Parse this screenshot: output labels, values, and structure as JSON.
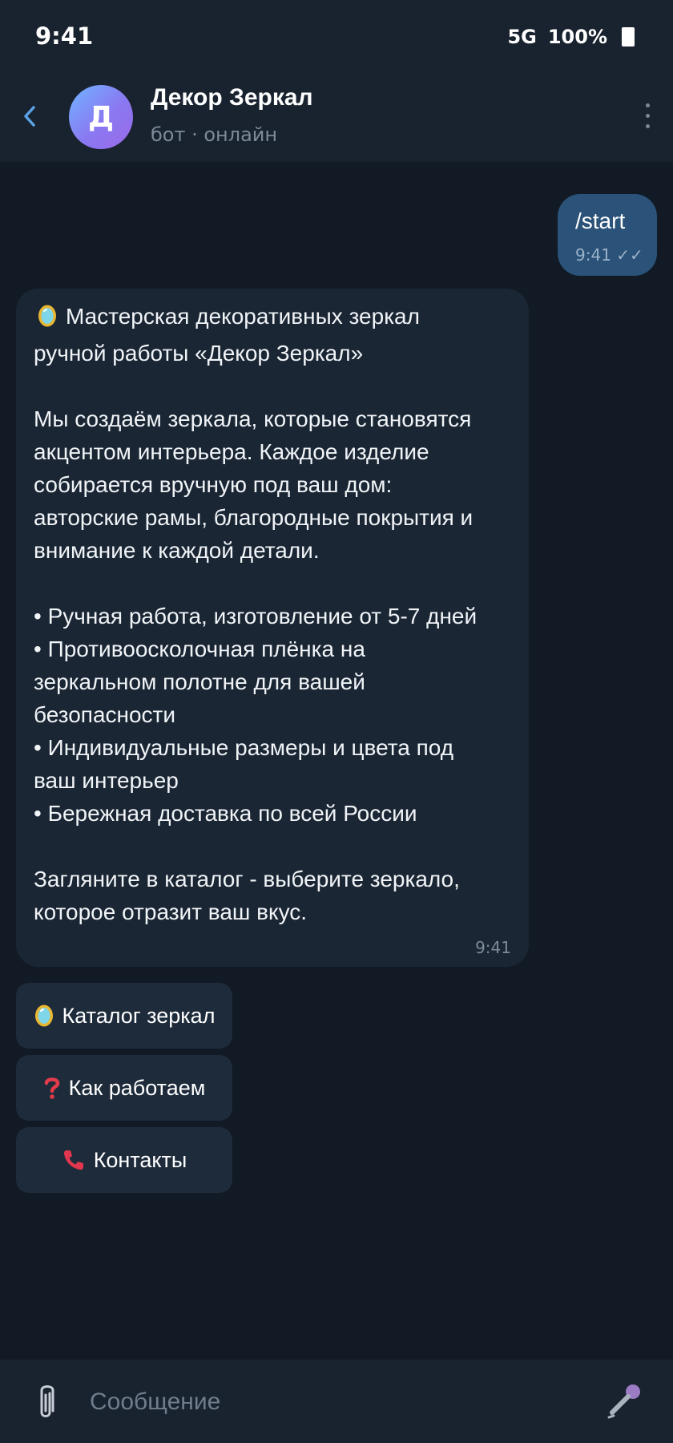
{
  "status_bar": {
    "time": "9:41",
    "network": "5G",
    "battery": "100%"
  },
  "header": {
    "avatar_letter": "Д",
    "title": "Декор Зеркал",
    "subtitle": "бот · онлайн"
  },
  "messages": {
    "outgoing": {
      "text": "/start",
      "time": "9:41 ✓✓"
    },
    "incoming": {
      "lines": [
        "Мастерская декоративных зеркал",
        "ручной работы «Декор Зеркал»",
        "Мы создаём зеркала, которые становятся",
        "акцентом интерьера. Каждое изделие",
        "собирается вручную под ваш дом:",
        "авторские рамы, благородные покрытия и",
        "внимание к каждой детали.",
        "• Ручная работа, изготовление от 5-7 дней",
        "• Противоосколочная плёнка на",
        "зеркальном полотне для вашей",
        "безопасности",
        "• Индивидуальные размеры и цвета под",
        "ваш интерьер",
        "• Бережная доставка по всей России",
        "Загляните в каталог - выберите зеркало,",
        "которое отразит ваш вкус."
      ],
      "time": "9:41"
    }
  },
  "inline_buttons": [
    {
      "label": "Каталог зеркал",
      "icon": "mirror-icon"
    },
    {
      "label": "Как работаем",
      "icon": "question-icon"
    },
    {
      "label": "Контакты",
      "icon": "phone-icon"
    }
  ],
  "input": {
    "placeholder": "Сообщение"
  },
  "colors": {
    "background": "#111a25",
    "header": "#19232f",
    "outgoing_bubble": "#2b5278",
    "incoming_bubble": "#1a2634",
    "inline_button": "#1e2b3b",
    "accent": "#5aa2e6"
  }
}
